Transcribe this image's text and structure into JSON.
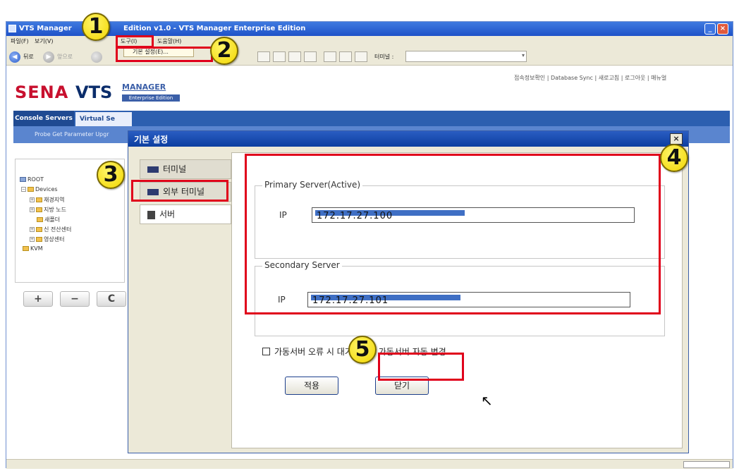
{
  "window": {
    "title_left": "VTS Manager",
    "title_right": "Edition v1.0 - VTS Manager Enterprise Edition",
    "min_glyph": "_",
    "close_glyph": "×"
  },
  "menu": {
    "file": "파일(F)",
    "view": "보기(V)",
    "tools": "도구(I)",
    "help": "도움말(H)",
    "tools_dropdown_item": "기본 설정(E)..."
  },
  "toolbar": {
    "back_label": "뒤로",
    "forward_label": "앞으로",
    "terminal_label": "터미널 :",
    "terminal_value": ""
  },
  "top_links": "접속정보확인 | Database Sync | 새로고침 | 로그아웃 | 매뉴얼",
  "logo": {
    "sena": "SENA",
    "vts": "VTS",
    "manager": "MANAGER",
    "edition": "Enterprise Edition"
  },
  "nav": {
    "tab_console": "Console Servers",
    "tab_virtual": "Virtual Se",
    "sub_links": "Probe  Get Parameter  Upgr"
  },
  "tree": {
    "root": "ROOT",
    "devices": "Devices",
    "children": [
      "재경지역",
      "지방 노드",
      "새폴더",
      "신 전산센터",
      "영상센터"
    ],
    "kvm": "KVM"
  },
  "tree_buttons": {
    "add": "+",
    "remove": "−",
    "refresh": "C"
  },
  "dialog": {
    "title": "기본 설정",
    "close": "×",
    "tabs": [
      "터미널",
      "외부 터미널",
      "서버"
    ],
    "primary_legend": "Primary Server(Active)",
    "primary_ip_label": "IP",
    "primary_ip": "172.17.27.100",
    "secondary_legend": "Secondary Server",
    "secondary_ip_label": "IP",
    "secondary_ip": "172.17.27.101",
    "auto_switch_label": "가동서버 오류 시 대기서버를 가동서버 자동 변경",
    "auto_switch_checked": false,
    "apply": "적용",
    "close_button": "닫기"
  },
  "annotations": {
    "step1": "1",
    "step2": "2",
    "step3": "3",
    "step4": "4",
    "step5": "5",
    "highlight_color": "#e0001b",
    "badge_color": "#f2d600"
  }
}
